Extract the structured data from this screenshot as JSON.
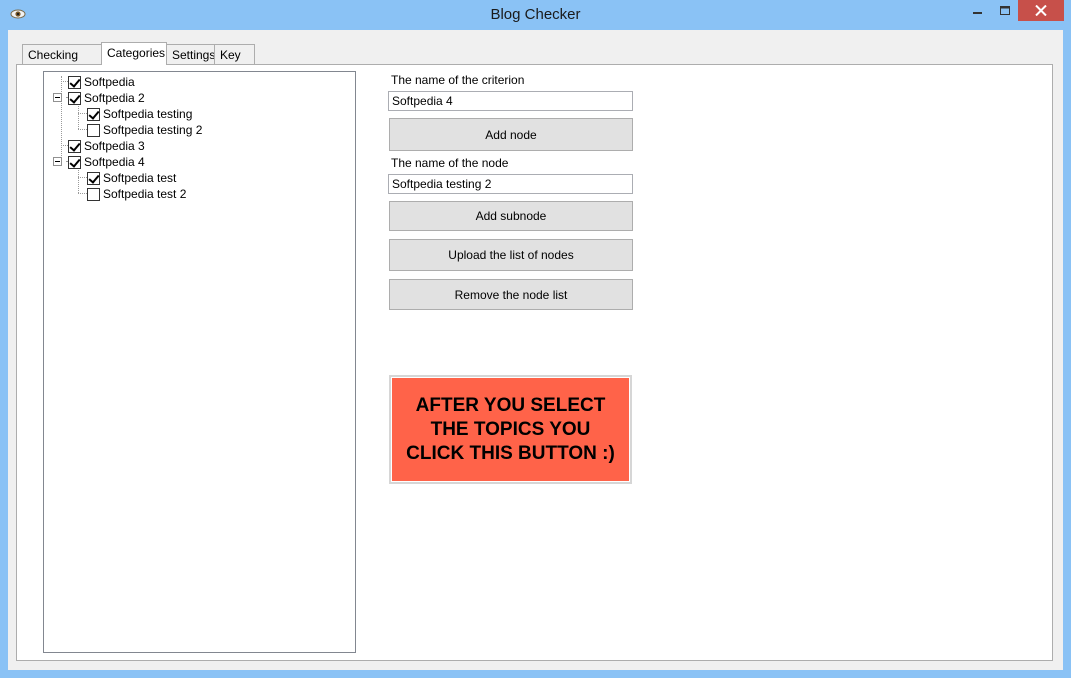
{
  "window": {
    "title": "Blog Checker",
    "close_color": "#c7504a",
    "titlebar_color": "#8ac2f5"
  },
  "tabs": [
    {
      "label": "Checking links"
    },
    {
      "label": "Categories",
      "active": true
    },
    {
      "label": "Settings"
    },
    {
      "label": "Key"
    }
  ],
  "tree": {
    "nodes": [
      {
        "label": "Softpedia",
        "checked": true,
        "level": 0
      },
      {
        "label": "Softpedia 2",
        "checked": true,
        "level": 0,
        "expanded": true
      },
      {
        "label": "Softpedia testing",
        "checked": true,
        "level": 1
      },
      {
        "label": "Softpedia testing 2",
        "checked": false,
        "level": 1
      },
      {
        "label": "Softpedia 3",
        "checked": true,
        "level": 0
      },
      {
        "label": "Softpedia 4",
        "checked": true,
        "level": 0,
        "expanded": true
      },
      {
        "label": "Softpedia test",
        "checked": true,
        "level": 1
      },
      {
        "label": "Softpedia test 2",
        "checked": false,
        "level": 1
      }
    ]
  },
  "form": {
    "criterion_label": "The name of the criterion",
    "criterion_value": "Softpedia 4",
    "add_node_label": "Add node",
    "node_label": "The name of the node",
    "node_value": "Softpedia testing 2",
    "add_subnode_label": "Add subnode",
    "upload_label": "Upload the list of nodes",
    "remove_label": "Remove the node list",
    "big_button_label": "AFTER YOU SELECT\nTHE TOPICS YOU\nCLICK THIS BUTTON :)",
    "big_button_color": "#ff6349"
  }
}
